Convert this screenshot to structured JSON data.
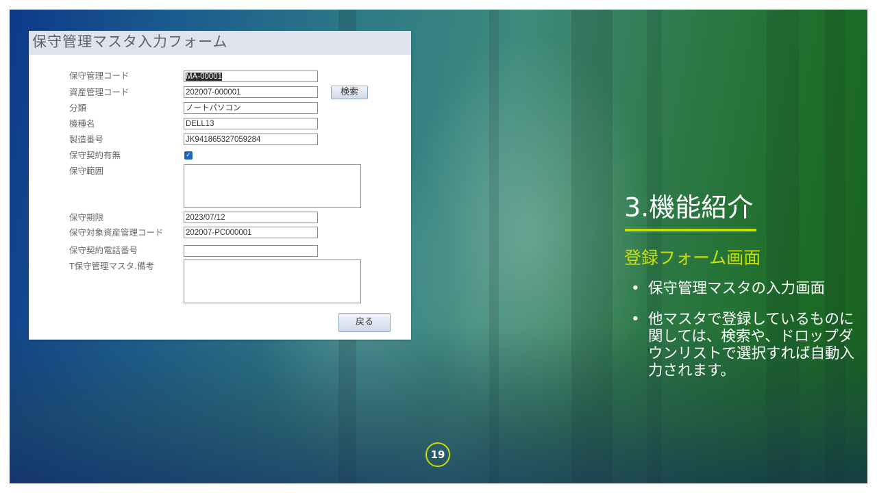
{
  "form": {
    "title": "保守管理マスタ入力フォーム",
    "fields": {
      "maintenance_code": {
        "label": "保守管理コード",
        "value": "MA-00001"
      },
      "asset_code": {
        "label": "資産管理コード",
        "value": "202007-000001"
      },
      "category": {
        "label": "分類",
        "value": "ノートパソコン"
      },
      "model_name": {
        "label": "機種名",
        "value": "DELL13"
      },
      "serial_number": {
        "label": "製造番号",
        "value": "JK941865327059284"
      },
      "contract_flag": {
        "label": "保守契約有無",
        "checked": true
      },
      "scope": {
        "label": "保守範囲",
        "value": ""
      },
      "expiry": {
        "label": "保守期限",
        "value": "2023/07/12"
      },
      "target_asset_code": {
        "label": "保守対象資産管理コード",
        "value": "202007-PC000001"
      },
      "contract_phone": {
        "label": "保守契約電話番号",
        "value": ""
      },
      "remarks": {
        "label": "T保守管理マスタ.備考",
        "value": ""
      }
    },
    "search_button": "検索",
    "back_button": "戻る"
  },
  "slide": {
    "title": "3.機能紹介",
    "subtitle": "登録フォーム画面",
    "bullets": [
      "保守管理マスタの入力画面",
      "他マスタで登録しているものに関しては、検索や、ドロップダウンリストで選択すれば自動入力されます。"
    ],
    "bullet_symbol": "•",
    "page_number": "19",
    "accent_color": "#c8e00a",
    "checkbox_mark": "✓"
  }
}
